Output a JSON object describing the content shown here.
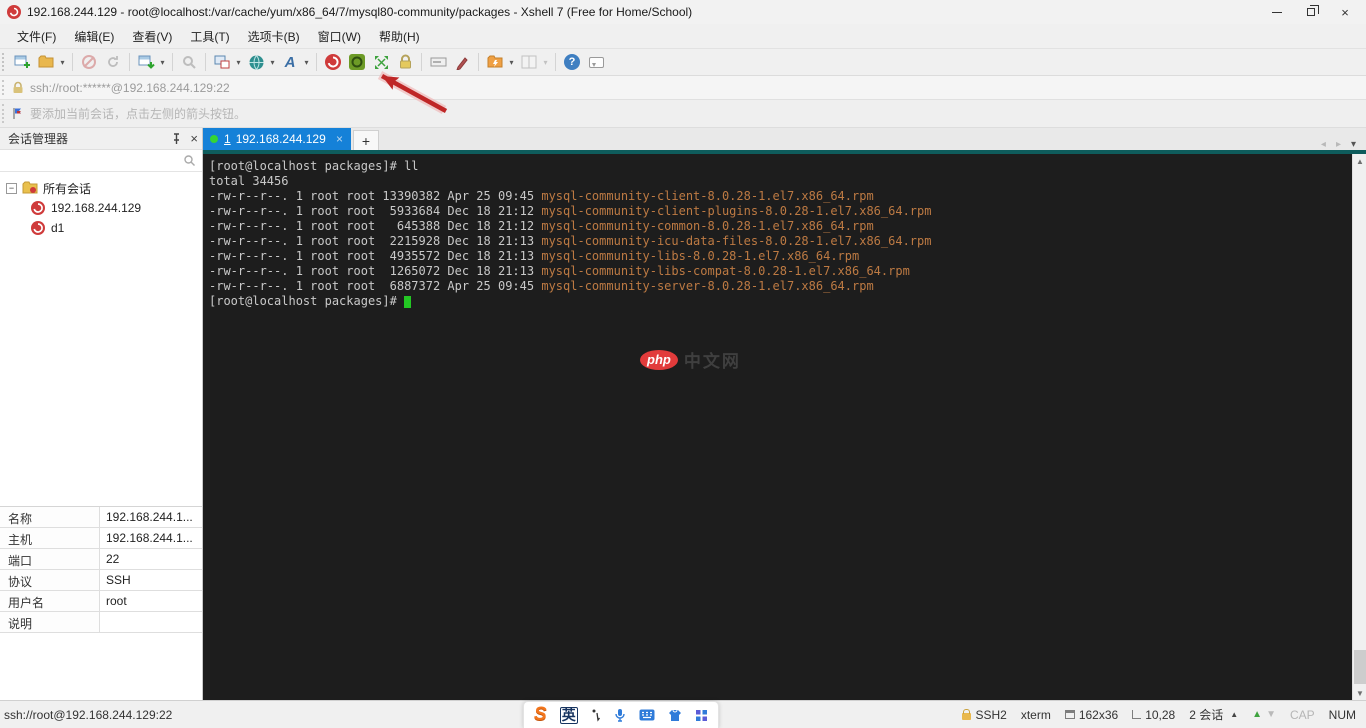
{
  "window": {
    "title": "192.168.244.129 - root@localhost:/var/cache/yum/x86_64/7/mysql80-community/packages - Xshell 7 (Free for Home/School)"
  },
  "menu": {
    "items": {
      "file": "文件(F)",
      "edit": "编辑(E)",
      "view": "查看(V)",
      "tools": "工具(T)",
      "tab": "选项卡(B)",
      "window": "窗口(W)",
      "help": "帮助(H)"
    }
  },
  "addressbar": {
    "url": "ssh://root:******@192.168.244.129:22"
  },
  "notice": {
    "text": "要添加当前会话，点击左侧的箭头按钮。"
  },
  "session_manager": {
    "title": "会话管理器",
    "root_label": "所有会话",
    "sessions": [
      {
        "label": "192.168.244.129"
      },
      {
        "label": "d1"
      }
    ]
  },
  "tabs": {
    "active_index": "1",
    "active_label": "192.168.244.129",
    "close_glyph": "×",
    "new_tab_label": "+"
  },
  "terminal": {
    "line_cmd": "[root@localhost packages]# ll",
    "line_total": "total 34456",
    "files": [
      {
        "meta": "-rw-r--r--. 1 root root 13390382 Apr 25 09:45 ",
        "name": "mysql-community-client-8.0.28-1.el7.x86_64.rpm"
      },
      {
        "meta": "-rw-r--r--. 1 root root  5933684 Dec 18 21:12 ",
        "name": "mysql-community-client-plugins-8.0.28-1.el7.x86_64.rpm"
      },
      {
        "meta": "-rw-r--r--. 1 root root   645388 Dec 18 21:12 ",
        "name": "mysql-community-common-8.0.28-1.el7.x86_64.rpm"
      },
      {
        "meta": "-rw-r--r--. 1 root root  2215928 Dec 18 21:13 ",
        "name": "mysql-community-icu-data-files-8.0.28-1.el7.x86_64.rpm"
      },
      {
        "meta": "-rw-r--r--. 1 root root  4935572 Dec 18 21:13 ",
        "name": "mysql-community-libs-8.0.28-1.el7.x86_64.rpm"
      },
      {
        "meta": "-rw-r--r--. 1 root root  1265072 Dec 18 21:13 ",
        "name": "mysql-community-libs-compat-8.0.28-1.el7.x86_64.rpm"
      },
      {
        "meta": "-rw-r--r--. 1 root root  6887372 Apr 25 09:45 ",
        "name": "mysql-community-server-8.0.28-1.el7.x86_64.rpm"
      }
    ],
    "prompt": "[root@localhost packages]# "
  },
  "watermark": {
    "logo": "php",
    "text": "中文网"
  },
  "properties": {
    "rows": [
      {
        "label": "名称",
        "value": "192.168.244.1..."
      },
      {
        "label": "主机",
        "value": "192.168.244.1..."
      },
      {
        "label": "端口",
        "value": "22"
      },
      {
        "label": "协议",
        "value": "SSH"
      },
      {
        "label": "用户名",
        "value": "root"
      },
      {
        "label": "说明",
        "value": ""
      }
    ]
  },
  "statusbar": {
    "connection": "ssh://root@192.168.244.129:22",
    "encryption": "SSH2",
    "terminal_type": "xterm",
    "screen_size": "162x36",
    "cursor_position": "10,28",
    "session_count": "2 会话",
    "caps_indicator": "CAP",
    "num_indicator": "NUM"
  },
  "ime": {
    "logo": "S",
    "mode": "英"
  },
  "colors": {
    "active_tab_blue": "#1581d8",
    "teal_strip": "#0e5c5c",
    "terminal_bg": "#1d1d1d",
    "terminal_text": "#c9c9c9",
    "file_orange": "#bd7a43",
    "cursor_green": "#23c723",
    "annotation_red": "#bf2727",
    "xshell_red": "#cf3b3b",
    "xftp_green": "#6d9b27"
  }
}
